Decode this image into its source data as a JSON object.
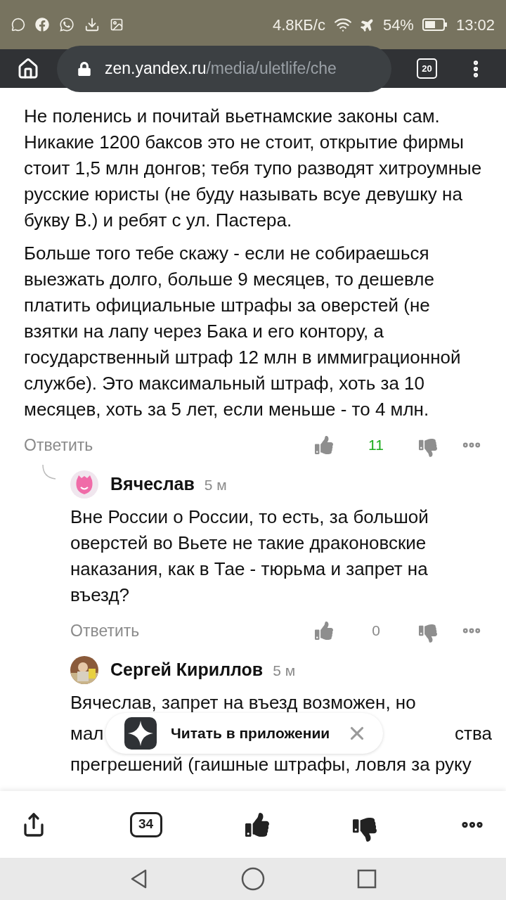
{
  "status_bar": {
    "net_speed": "4.8КБ/с",
    "battery": "54%",
    "time": "13:02"
  },
  "browser": {
    "url_host": "zen.yandex.ru",
    "url_path": "/media/uletlife/che",
    "tab_count": "20"
  },
  "comments": [
    {
      "kind": "root",
      "paragraphs": [
        "Не поленись и почитай вьетнамские законы сам. Никакие 1200 баксов это не стоит, открытие фирмы стоит 1,5 млн донгов; тебя тупо разводят хитроумные русские юристы (не буду называть всуе девушку на букву В.) и ребят с ул. Пастера.",
        "Больше того тебе скажу - если не собираешься выезжать долго, больше 9 месяцев, то дешевле платить официальные штрафы за оверстей (не взятки на лапу через Бака и его контору, а государственный штраф 12 млн в иммиграционной службе). Это максимальный штраф, хоть за 10 месяцев, хоть за 5 лет, если меньше - то 4 млн."
      ],
      "reply": "Ответить",
      "likes": "11"
    },
    {
      "kind": "reply",
      "author": "Вячеслав",
      "time": "5 м",
      "paragraphs": [
        "Вне России о России, то есть, за большой оверстей во Вьете не такие драконовские наказания, как в Тае - тюрьма и запрет на въезд?"
      ],
      "reply": "Ответить",
      "likes": "0"
    },
    {
      "kind": "partial",
      "author": "Сергей Кириллов",
      "time": "5 м",
      "lines": [
        [
          "Вячеслав, запрет на въезд возможен, но"
        ],
        [
          "мал",
          "ства"
        ],
        [
          "прегрешений (гаишные штрафы, ловля за руку"
        ]
      ]
    }
  ],
  "popup": {
    "label": "Читать в приложении"
  },
  "bottom_bar": {
    "comments_count": "34"
  }
}
